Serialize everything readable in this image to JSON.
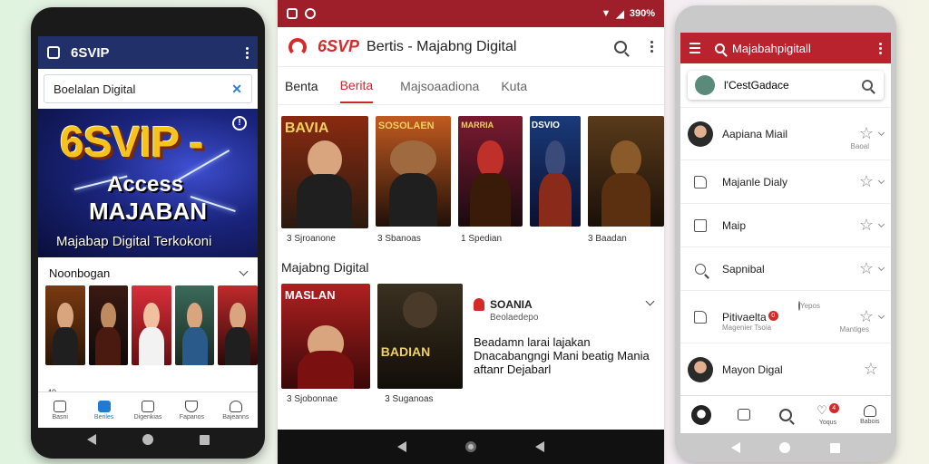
{
  "phone_left": {
    "app_title": "6SVIP",
    "search_text": "Boelalan Digital",
    "banner": {
      "title": "6SVIP -",
      "line1": "Access",
      "line2": "MAJABAN",
      "line3": "Majabap Digital Terkokoni"
    },
    "section_title": "Noonbogan",
    "row_text": "40",
    "nav": [
      {
        "label": "Basni",
        "icon": "home-icon"
      },
      {
        "label": "Beriles",
        "icon": "discover-icon"
      },
      {
        "label": "Digenkias",
        "icon": "library-icon"
      },
      {
        "label": "Fapanos",
        "icon": "shield-icon"
      },
      {
        "label": "Bajeanns",
        "icon": "profile-icon"
      }
    ]
  },
  "phone_middle": {
    "status_right": "390%",
    "brand": "6SVP",
    "app_title": "Bertis - Majabng Digital",
    "tabs": [
      "Benta",
      "Berita",
      "Majsoaadiona",
      "Kuta"
    ],
    "row1_labels": [
      "3 Sjroanone",
      "3 Sbanoas",
      "1 Spedian",
      "3 Baadan"
    ],
    "section_title": "Majabng Digital",
    "row2_labels": [
      "3 Sjobonnae",
      "3 Suganoas"
    ],
    "poster_titles": [
      "BAVIA",
      "SOSOLAEN",
      "MARRIA",
      "DSVIO",
      "",
      "MASLAN",
      "BADIAN"
    ],
    "feature": {
      "name": "SOANIA",
      "sub": "Beolaedepo",
      "desc": "Beadamn larai lajakan Dnacabangngi Mani beatig Mania aftanr Dejabarl"
    }
  },
  "phone_right": {
    "app_title": "Majabahpigitall",
    "search_text": "l'CestGadace",
    "items": [
      {
        "label": "Aapiana Miail",
        "sub": "",
        "star_sub": "Baoal",
        "lead": "avatar"
      },
      {
        "label": "Majanle Dialy",
        "sub": "",
        "star_sub": "",
        "lead": "doc"
      },
      {
        "label": "Maip",
        "sub": "",
        "star_sub": "",
        "lead": "square"
      },
      {
        "label": "Sapnibal",
        "sub": "",
        "star_sub": "",
        "lead": "search"
      },
      {
        "label": "Pitivaelta",
        "sub": "Magenier Tsoia",
        "star_sub": "Mantiges",
        "lead": "doc",
        "badge": "0",
        "extra_label": "Yepos"
      },
      {
        "label": "Mayon Digal",
        "sub": "",
        "star_sub": "",
        "lead": "avatar"
      }
    ],
    "nav": [
      {
        "label": "",
        "icon": "avatar-icon"
      },
      {
        "label": "",
        "icon": "library-icon"
      },
      {
        "label": "",
        "icon": "search-icon"
      },
      {
        "label": "Yoqus",
        "icon": "heart-icon",
        "badge": "4"
      },
      {
        "label": "Babois",
        "icon": "profile-icon"
      }
    ]
  },
  "colors": {
    "left_appbar": "#22306a",
    "middle_status": "#9e1f2a",
    "accent_red": "#c62a2a",
    "right_appbar": "#b8232e"
  }
}
